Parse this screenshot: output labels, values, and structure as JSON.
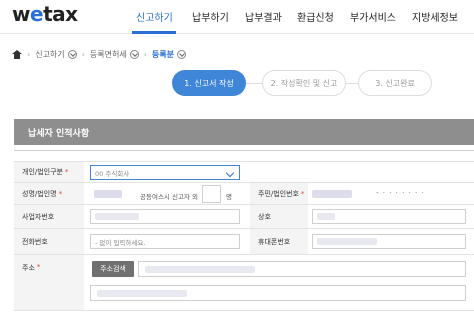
{
  "header": {
    "logo_w": "w",
    "logo_rest": "tax",
    "nav": [
      "신고하기",
      "납부하기",
      "납부결과",
      "환급신청",
      "부가서비스",
      "지방세정보"
    ]
  },
  "breadcrumb": {
    "items": [
      "신고하기",
      "등록면허세"
    ],
    "current": "등록분"
  },
  "steps": [
    {
      "label": "1. 신고서 작성",
      "state": "active"
    },
    {
      "label": "2. 작성확인 및 신고",
      "state": "inactive"
    },
    {
      "label": "3. 신고완료",
      "state": "inactive"
    }
  ],
  "section": {
    "title": "납세자 인적사항"
  },
  "form": {
    "type_label": "개인/법인구분",
    "type_value": "00 주식회사",
    "name_label": "성명/법인명",
    "co_reporter_label": "공동여스시 신고자 외",
    "co_reporter_unit": "명",
    "reg_no_label": "주민/법인번호",
    "reg_no_mask": "- · · · · · · ·",
    "biz_no_label": "사업자번호",
    "trade_name_label": "상호",
    "phone_label": "전화번호",
    "phone_placeholder": "- 없이 입력하세요.",
    "mobile_label": "휴대폰번호",
    "address_label": "주소",
    "address_search_button": "주소검색"
  },
  "colors": {
    "accent": "#2a6fd6",
    "active_step": "#3f86d9",
    "section_bar": "#8e8e8e",
    "required": "#e23c3c"
  }
}
